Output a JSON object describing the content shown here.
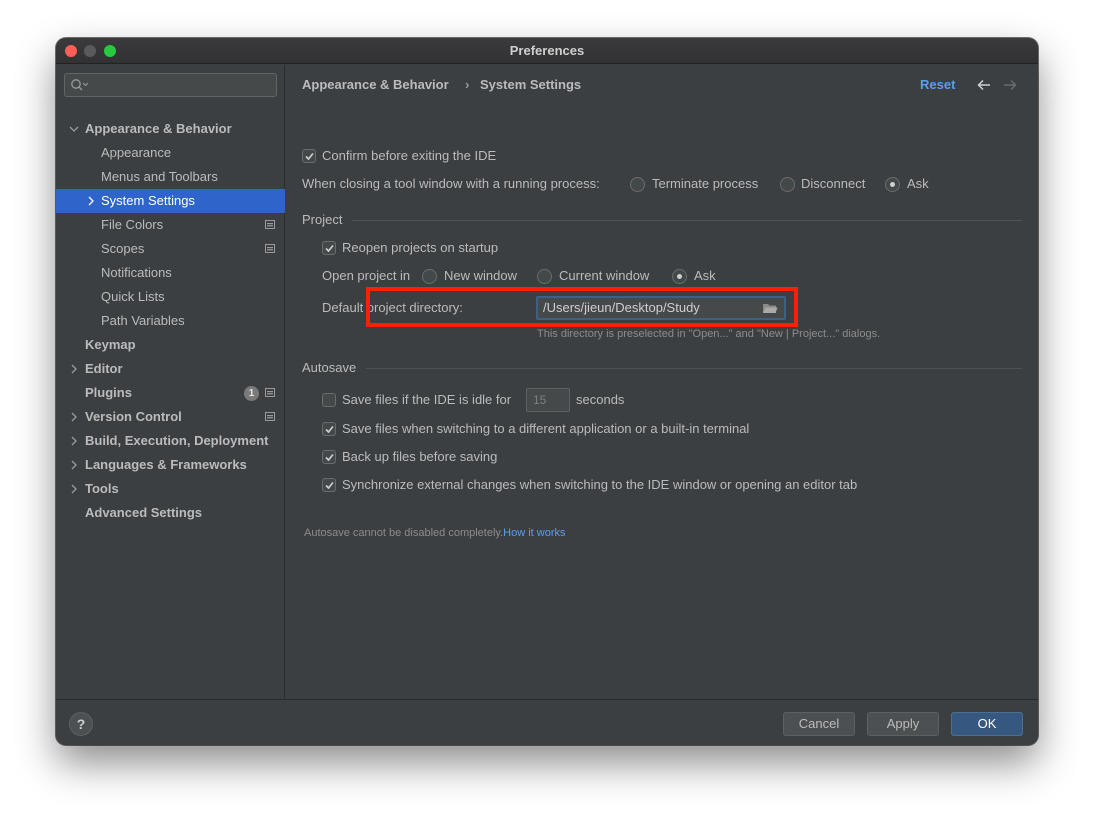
{
  "window": {
    "title": "Preferences"
  },
  "sidebar": {
    "search_placeholder": "",
    "items": [
      {
        "label": "Appearance & Behavior",
        "expanded": true
      },
      {
        "label": "Appearance"
      },
      {
        "label": "Menus and Toolbars"
      },
      {
        "label": "System Settings",
        "selected": true
      },
      {
        "label": "File Colors"
      },
      {
        "label": "Scopes"
      },
      {
        "label": "Notifications"
      },
      {
        "label": "Quick Lists"
      },
      {
        "label": "Path Variables"
      },
      {
        "label": "Keymap"
      },
      {
        "label": "Editor"
      },
      {
        "label": "Plugins",
        "badge": "1"
      },
      {
        "label": "Version Control"
      },
      {
        "label": "Build, Execution, Deployment"
      },
      {
        "label": "Languages & Frameworks"
      },
      {
        "label": "Tools"
      },
      {
        "label": "Advanced Settings"
      }
    ]
  },
  "header": {
    "breadcrumb_parent": "Appearance & Behavior",
    "breadcrumb_separator": "›",
    "breadcrumb_current": "System Settings",
    "reset_label": "Reset"
  },
  "settings": {
    "confirm_exit": {
      "label": "Confirm before exiting the IDE",
      "checked": true
    },
    "closing_tool_window": {
      "label": "When closing a tool window with a running process:",
      "options": [
        "Terminate process",
        "Disconnect",
        "Ask"
      ],
      "selected": "Ask"
    },
    "project": {
      "section_title": "Project",
      "reopen": {
        "label": "Reopen projects on startup",
        "checked": true
      },
      "open_project_in": {
        "label": "Open project in",
        "options": [
          "New window",
          "Current window",
          "Ask"
        ],
        "selected": "Ask"
      },
      "default_dir": {
        "label": "Default project directory:",
        "value": "/Users/jieun/Desktop/Study",
        "hint": "This directory is preselected in \"Open...\" and \"New | Project...\" dialogs."
      }
    },
    "autosave": {
      "section_title": "Autosave",
      "idle": {
        "label_before": "Save files if the IDE is idle for",
        "value": "15",
        "label_after": "seconds",
        "checked": false
      },
      "switching": {
        "label": "Save files when switching to a different application or a built-in terminal",
        "checked": true
      },
      "backup": {
        "label": "Back up files before saving",
        "checked": true
      },
      "sync": {
        "label": "Synchronize external changes when switching to the IDE window or opening an editor tab",
        "checked": true
      },
      "note": "Autosave cannot be disabled completely.",
      "note_link": "How it works"
    }
  },
  "footer": {
    "help_label": "?",
    "cancel_label": "Cancel",
    "apply_label": "Apply",
    "ok_label": "OK"
  },
  "colors": {
    "accent": "#2f65ca",
    "link": "#589df6",
    "highlight_box": "#ff1e0a",
    "primary_button": "#365880"
  }
}
